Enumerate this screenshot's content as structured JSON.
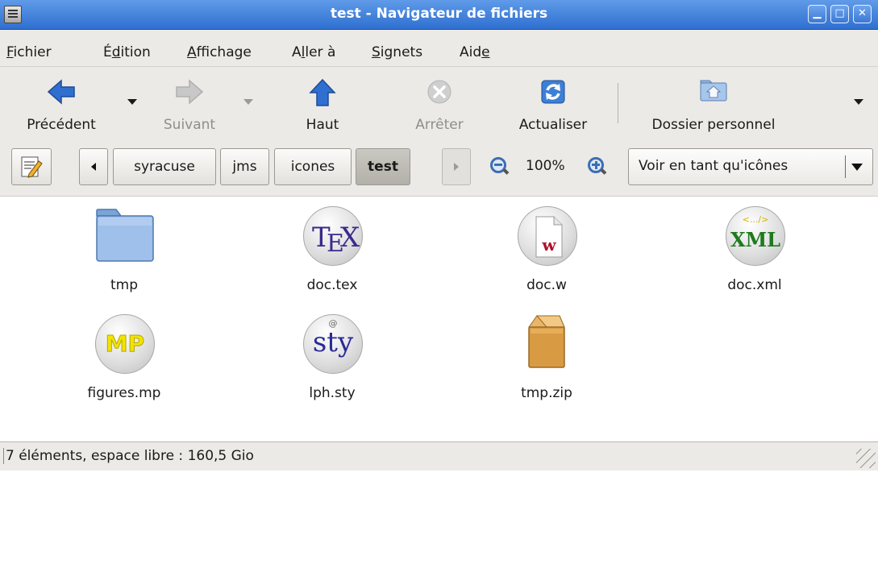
{
  "window": {
    "title": "test - Navigateur de fichiers",
    "buttons": [
      "minimize",
      "maximize",
      "close"
    ]
  },
  "menu": [
    {
      "pre": "",
      "u": "F",
      "post": "ichier"
    },
    {
      "pre": "É",
      "u": "d",
      "post": "ition"
    },
    {
      "pre": "",
      "u": "A",
      "post": "ffichage"
    },
    {
      "pre": "A",
      "u": "l",
      "post": "ler à"
    },
    {
      "pre": "",
      "u": "S",
      "post": "ignets"
    },
    {
      "pre": "Aid",
      "u": "e",
      "post": ""
    }
  ],
  "toolbar": {
    "back_label": "Précédent",
    "forward_label": "Suivant",
    "up_label": "Haut",
    "stop_label": "Arrêter",
    "reload_label": "Actualiser",
    "home_label": "Dossier personnel"
  },
  "location": {
    "path": [
      "syracuse",
      "jms",
      "icones",
      "test"
    ],
    "active": "test",
    "zoom": "100%",
    "view_mode": "Voir en tant qu'icônes"
  },
  "files": [
    {
      "name": "tmp",
      "type": "folder"
    },
    {
      "name": "doc.tex",
      "type": "tex",
      "icon_text": "TEX"
    },
    {
      "name": "doc.w",
      "type": "w",
      "icon_text": "w"
    },
    {
      "name": "doc.xml",
      "type": "xml",
      "icon_text": "XML",
      "icon_subtext": "<.../>"
    },
    {
      "name": "figures.mp",
      "type": "mp",
      "icon_text": "MP"
    },
    {
      "name": "lph.sty",
      "type": "sty",
      "icon_text": "sty",
      "icon_subtext": "@"
    },
    {
      "name": "tmp.zip",
      "type": "zip"
    }
  ],
  "status": "7 éléments, espace libre : 160,5 Gio",
  "colors": {
    "titlebar": "#3a7ad8",
    "chrome": "#eceae6",
    "folder": "#8fb6e6",
    "tex": "#3b2a8c",
    "w": "#b0102a",
    "xml_text": "#1f7a1f",
    "xml_sub": "#d6b400",
    "mp": "#f2e400",
    "zip": "#d89a42"
  }
}
